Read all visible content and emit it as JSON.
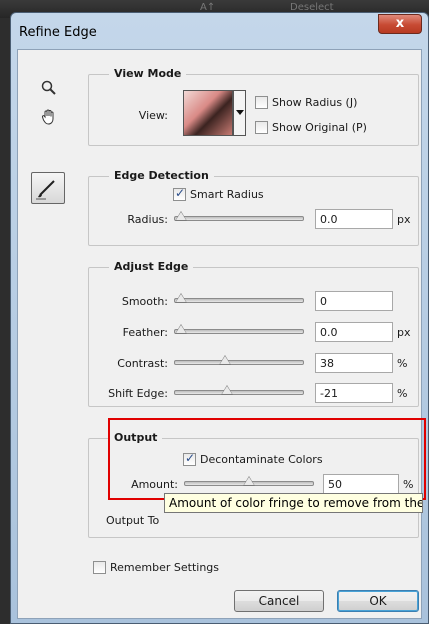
{
  "background": {
    "ghost_icon": "A↑",
    "ghost_text": "Deselect"
  },
  "window": {
    "title": "Refine Edge",
    "close_label": "x"
  },
  "tools": {
    "zoom": "zoom-icon",
    "hand": "hand-icon",
    "refine_brush": "brush-icon"
  },
  "view_mode": {
    "title": "View Mode",
    "view_label": "View:",
    "show_radius": {
      "label": "Show Radius (J)",
      "checked": false
    },
    "show_original": {
      "label": "Show Original (P)",
      "checked": false
    }
  },
  "edge_detection": {
    "title": "Edge Detection",
    "smart_radius": {
      "label": "Smart Radius",
      "checked": true
    },
    "radius": {
      "label": "Radius:",
      "value": "0.0",
      "unit": "px",
      "level": 0
    }
  },
  "adjust_edge": {
    "title": "Adjust Edge",
    "smooth": {
      "label": "Smooth:",
      "value": "0",
      "unit": "",
      "level": 0
    },
    "feather": {
      "label": "Feather:",
      "value": "0.0",
      "unit": "px",
      "level": 0
    },
    "contrast": {
      "label": "Contrast:",
      "value": "38",
      "unit": "%",
      "level": 0.38
    },
    "shift_edge": {
      "label": "Shift Edge:",
      "value": "-21",
      "unit": "%",
      "level": 0.395
    }
  },
  "output": {
    "title": "Output",
    "decontaminate": {
      "label": "Decontaminate Colors",
      "checked": true
    },
    "amount": {
      "label": "Amount:",
      "value": "50",
      "unit": "%",
      "level": 0.5
    },
    "output_to_label": "Output To"
  },
  "tooltip": "Amount of color fringe to remove from the",
  "remember": {
    "label": "Remember Settings",
    "checked": false
  },
  "buttons": {
    "cancel": "Cancel",
    "ok": "OK"
  },
  "colors": {
    "highlight": "#e00000",
    "tooltip_bg": "#ffffe1",
    "window_frame": "#c4d7ea"
  }
}
